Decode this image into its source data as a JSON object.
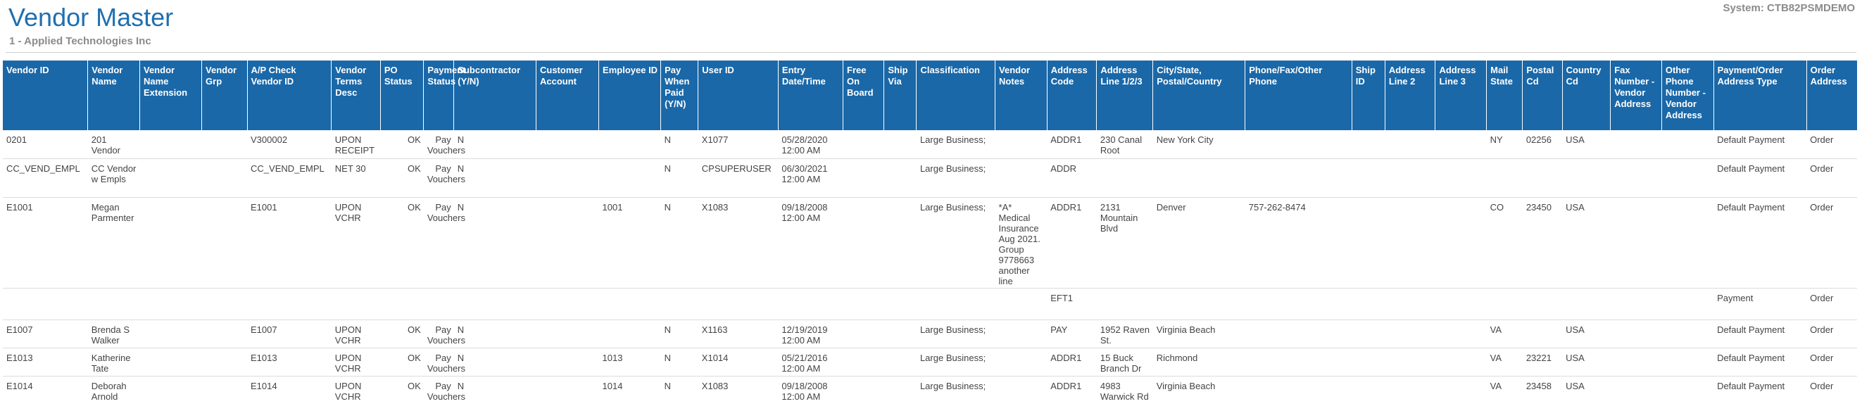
{
  "header": {
    "title": "Vendor Master",
    "company": "1 - Applied Technologies Inc",
    "system": "System:  CTB82PSMDEMO"
  },
  "columns": [
    "Vendor ID",
    "Vendor Name",
    "Vendor Name Extension",
    "Vendor Grp",
    "A/P Check Vendor ID",
    "Vendor Terms Desc",
    "PO Status",
    "Payment Status",
    "Subcontractor (Y/N)",
    "Customer Account",
    "Employee ID",
    "Pay When Paid (Y/N)",
    "User ID",
    "Entry Date/Time",
    "Free On Board",
    "Ship Via",
    "Classification",
    "Vendor Notes",
    "Address Code",
    "Address Line 1/2/3",
    "City/State, Postal/Country",
    "Phone/Fax/Other Phone",
    "Ship ID",
    "Address Line 2",
    "Address Line 3",
    "Mail State",
    "Postal Cd",
    "Country Cd",
    "Fax Number - Vendor Address",
    "Other Phone Number - Vendor Address",
    "Payment/Order Address Type",
    "Order Address"
  ],
  "rows": [
    [
      "0201",
      "201 Vendor",
      "",
      "",
      "V300002",
      "UPON RECEIPT",
      "OK",
      "Pay Vouchers",
      "N",
      "",
      "",
      "N",
      "X1077",
      "05/28/2020 12:00 AM",
      "",
      "",
      "Large Business;",
      "",
      "ADDR1",
      "230 Canal Root",
      "New York City",
      "",
      "",
      "",
      "",
      "NY",
      "02256",
      "USA",
      "",
      "",
      "Default Payment",
      "Order"
    ],
    [
      "CC_VEND_EMPL",
      "CC Vendor w Empls",
      "",
      "",
      "CC_VEND_EMPL",
      "NET 30",
      "OK",
      "Pay Vouchers",
      "N",
      "",
      "",
      "N",
      "CPSUPERUSER",
      "06/30/2021 12:00 AM",
      "",
      "",
      "Large Business;",
      "",
      "ADDR",
      "",
      "",
      "",
      "",
      "",
      "",
      "",
      "",
      "",
      "",
      "",
      "Default Payment",
      "Order"
    ],
    [
      "E1001",
      "Megan Parmenter",
      "",
      "",
      "E1001",
      "UPON VCHR",
      "OK",
      "Pay Vouchers",
      "N",
      "",
      "1001",
      "N",
      "X1083",
      "09/18/2008 12:00 AM",
      "",
      "",
      "Large Business;",
      "*A* Medical Insurance Aug 2021. Group 9778663 another line",
      "ADDR1",
      "2131 Mountain Blvd",
      "Denver",
      "757-262-8474",
      "",
      "",
      "",
      "CO",
      "23450",
      "USA",
      "",
      "",
      "Default Payment",
      "Order"
    ],
    [
      "",
      "",
      "",
      "",
      "",
      "",
      "",
      "",
      "",
      "",
      "",
      "",
      "",
      "",
      "",
      "",
      "",
      "",
      "EFT1",
      "",
      "",
      "",
      "",
      "",
      "",
      "",
      "",
      "",
      "",
      "",
      "Payment",
      "Order"
    ],
    [
      "E1007",
      "Brenda S Walker",
      "",
      "",
      "E1007",
      "UPON VCHR",
      "OK",
      "Pay Vouchers",
      "N",
      "",
      "",
      "N",
      "X1163",
      "12/19/2019 12:00 AM",
      "",
      "",
      "Large Business;",
      "",
      "PAY",
      "1952 Raven St.",
      "Virginia Beach",
      "",
      "",
      "",
      "",
      "VA",
      "",
      "USA",
      "",
      "",
      "Default Payment",
      "Order"
    ],
    [
      "E1013",
      "Katherine Tate",
      "",
      "",
      "E1013",
      "UPON VCHR",
      "OK",
      "Pay Vouchers",
      "N",
      "",
      "1013",
      "N",
      "X1014",
      "05/21/2016 12:00 AM",
      "",
      "",
      "Large Business;",
      "",
      "ADDR1",
      "15 Buck Branch Dr",
      "Richmond",
      "",
      "",
      "",
      "",
      "VA",
      "23221",
      "USA",
      "",
      "",
      "Default Payment",
      "Order"
    ],
    [
      "E1014",
      "Deborah Arnold",
      "",
      "",
      "E1014",
      "UPON VCHR",
      "OK",
      "Pay Vouchers",
      "N",
      "",
      "1014",
      "N",
      "X1083",
      "09/18/2008 12:00 AM",
      "",
      "",
      "Large Business;",
      "",
      "ADDR1",
      "4983 Warwick Rd",
      "Virginia Beach",
      "",
      "",
      "",
      "",
      "VA",
      "23458",
      "USA",
      "",
      "",
      "Default Payment",
      "Order"
    ]
  ]
}
